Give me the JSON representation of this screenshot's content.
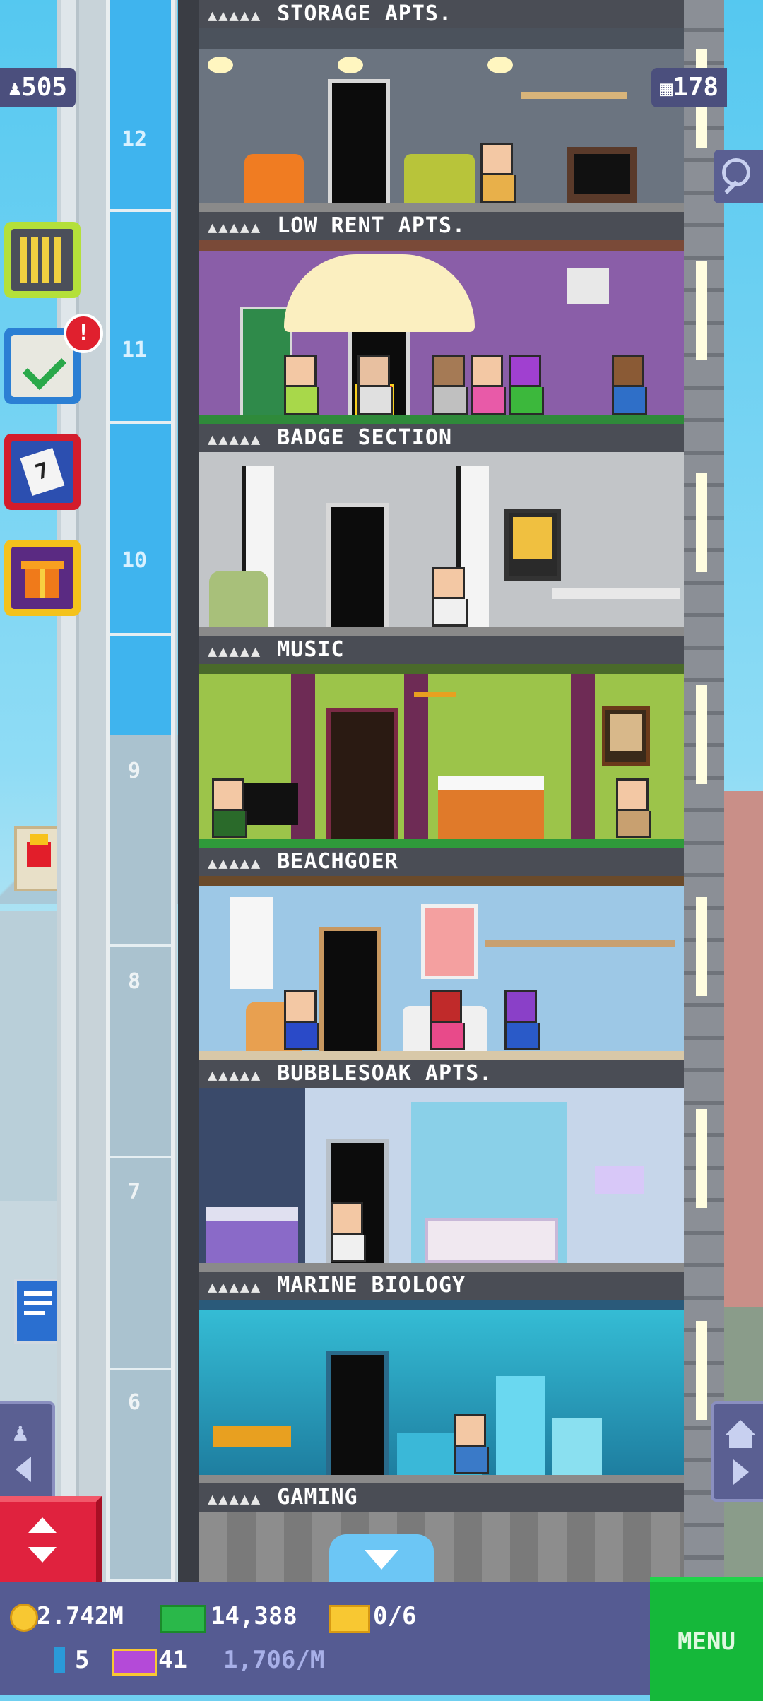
{
  "hud": {
    "population": "505",
    "floors": "178"
  },
  "shaft_floor_numbers": [
    "12",
    "11",
    "10",
    "9",
    "8",
    "7",
    "6"
  ],
  "floors": [
    {
      "name": "STORAGE APTS.",
      "stars": "▲▲▲▲▲",
      "wall": "#6b7480",
      "trim": "#4b525c"
    },
    {
      "name": "LOW RENT APTS.",
      "stars": "▲▲▲▲▲",
      "wall": "#8a5ea8",
      "trim": "#7a4a38"
    },
    {
      "name": "BADGE SECTION",
      "stars": "▲▲▲▲▲",
      "wall": "#b9bcbf",
      "trim": "#9a9da0"
    },
    {
      "name": "MUSIC",
      "stars": "▲▲▲▲▲",
      "wall": "#9cc44a",
      "trim": "#6e2b55"
    },
    {
      "name": "BEACHGOER",
      "stars": "▲▲▲▲▲",
      "wall": "#9dc8e6",
      "trim": "#f1e6cf"
    },
    {
      "name": "BUBBLESOAK APTS.",
      "stars": "▲▲▲▲▲",
      "wall": "#c6d6ea",
      "trim": "#8cb7e0"
    },
    {
      "name": "MARINE BIOLOGY",
      "stars": "▲▲▲▲▲",
      "wall": "#2aa8c8",
      "trim": "#1b6f8f"
    },
    {
      "name": "GAMING",
      "stars": "▲▲▲▲▲",
      "wall": "#8d8d8d",
      "trim": "#6f6f6f"
    }
  ],
  "side_buttons": [
    {
      "name": "build-floor-button",
      "icon": "building-icon",
      "color": "#4b4f5a",
      "border": "#b4e03a"
    },
    {
      "name": "missions-button",
      "icon": "checklist-icon",
      "color": "#3a4a86",
      "border": "#2b7fd4",
      "alert": "!"
    },
    {
      "name": "calendar-button",
      "icon": "calendar-icon",
      "color": "#2c4fb0",
      "border": "#d41c2b",
      "day": "7"
    },
    {
      "name": "gift-button",
      "icon": "gift-icon",
      "color": "#5a2a82",
      "border": "#f4c21c"
    }
  ],
  "bottom": {
    "coins": "2.742M",
    "bux": "14,388",
    "vip": "0/6",
    "keys": "5",
    "tickets": "41",
    "rate": "1,706/M",
    "menu_label": "MENU"
  }
}
